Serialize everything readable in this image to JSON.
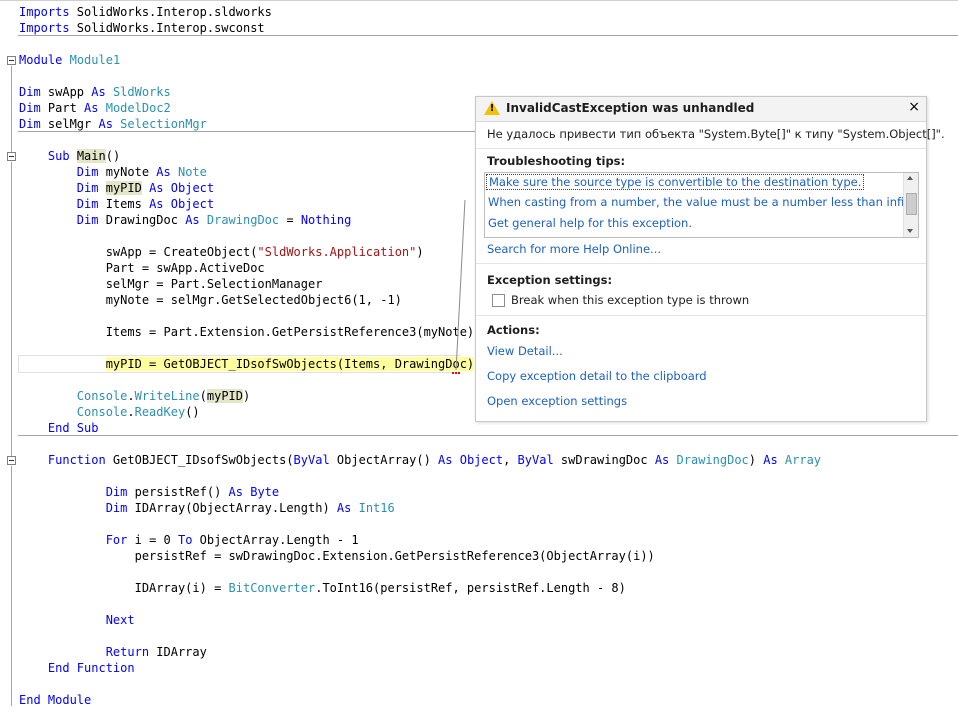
{
  "code": {
    "lines": [
      {
        "tokens": [
          {
            "t": "Imports",
            "c": "kw"
          },
          {
            "t": " SolidWorks.Interop.sldworks",
            "c": ""
          }
        ]
      },
      {
        "tokens": [
          {
            "t": "Imports",
            "c": "kw"
          },
          {
            "t": " SolidWorks.Interop.swconst",
            "c": ""
          }
        ]
      },
      {
        "tokens": []
      },
      {
        "tokens": [
          {
            "t": "Module",
            "c": "kw"
          },
          {
            "t": " ",
            "c": ""
          },
          {
            "t": "Module1",
            "c": "ty"
          }
        ]
      },
      {
        "tokens": []
      },
      {
        "tokens": [
          {
            "t": "Dim",
            "c": "kw"
          },
          {
            "t": " swApp ",
            "c": ""
          },
          {
            "t": "As",
            "c": "kw"
          },
          {
            "t": " ",
            "c": ""
          },
          {
            "t": "SldWorks",
            "c": "ty"
          }
        ]
      },
      {
        "tokens": [
          {
            "t": "Dim",
            "c": "kw"
          },
          {
            "t": " Part ",
            "c": ""
          },
          {
            "t": "As",
            "c": "kw"
          },
          {
            "t": " ",
            "c": ""
          },
          {
            "t": "ModelDoc2",
            "c": "ty"
          }
        ]
      },
      {
        "tokens": [
          {
            "t": "Dim",
            "c": "kw"
          },
          {
            "t": " selMgr ",
            "c": ""
          },
          {
            "t": "As",
            "c": "kw"
          },
          {
            "t": " ",
            "c": ""
          },
          {
            "t": "SelectionMgr",
            "c": "ty"
          }
        ]
      },
      {
        "tokens": []
      },
      {
        "tokens": [
          {
            "t": "    ",
            "c": ""
          },
          {
            "t": "Sub",
            "c": "kw"
          },
          {
            "t": " ",
            "c": ""
          },
          {
            "t": "Main",
            "c": "hl"
          },
          {
            "t": "()",
            "c": ""
          }
        ]
      },
      {
        "tokens": [
          {
            "t": "        ",
            "c": ""
          },
          {
            "t": "Dim",
            "c": "kw"
          },
          {
            "t": " myNote ",
            "c": ""
          },
          {
            "t": "As",
            "c": "kw"
          },
          {
            "t": " ",
            "c": ""
          },
          {
            "t": "Note",
            "c": "ty"
          }
        ]
      },
      {
        "tokens": [
          {
            "t": "        ",
            "c": ""
          },
          {
            "t": "Dim",
            "c": "kw"
          },
          {
            "t": " ",
            "c": ""
          },
          {
            "t": "myPID",
            "c": "hl"
          },
          {
            "t": " ",
            "c": ""
          },
          {
            "t": "As",
            "c": "kw"
          },
          {
            "t": " ",
            "c": ""
          },
          {
            "t": "Object",
            "c": "kw"
          }
        ]
      },
      {
        "tokens": [
          {
            "t": "        ",
            "c": ""
          },
          {
            "t": "Dim",
            "c": "kw"
          },
          {
            "t": " Items ",
            "c": ""
          },
          {
            "t": "As",
            "c": "kw"
          },
          {
            "t": " ",
            "c": ""
          },
          {
            "t": "Object",
            "c": "kw"
          }
        ]
      },
      {
        "tokens": [
          {
            "t": "        ",
            "c": ""
          },
          {
            "t": "Dim",
            "c": "kw"
          },
          {
            "t": " DrawingDoc ",
            "c": ""
          },
          {
            "t": "As",
            "c": "kw"
          },
          {
            "t": " ",
            "c": ""
          },
          {
            "t": "DrawingDoc",
            "c": "ty"
          },
          {
            "t": " = ",
            "c": ""
          },
          {
            "t": "Nothing",
            "c": "kw"
          }
        ]
      },
      {
        "tokens": []
      },
      {
        "tokens": [
          {
            "t": "            swApp = CreateObject(",
            "c": ""
          },
          {
            "t": "\"SldWorks.Application\"",
            "c": "str"
          },
          {
            "t": ")",
            "c": ""
          }
        ]
      },
      {
        "tokens": [
          {
            "t": "            Part = swApp.ActiveDoc",
            "c": ""
          }
        ]
      },
      {
        "tokens": [
          {
            "t": "            selMgr = Part.SelectionManager",
            "c": ""
          }
        ]
      },
      {
        "tokens": [
          {
            "t": "            myNote = selMgr.GetSelectedObject6(1, -1)",
            "c": ""
          }
        ]
      },
      {
        "tokens": []
      },
      {
        "tokens": [
          {
            "t": "            Items = Part.Extension.GetPersistReference3(myNote)",
            "c": ""
          }
        ]
      },
      {
        "tokens": []
      },
      {
        "tokens": [
          {
            "t": "            myPID = GetOBJECT_IDsofSwObjects(Items, DrawingDoc)",
            "c": "exec"
          }
        ]
      },
      {
        "tokens": []
      },
      {
        "tokens": [
          {
            "t": "        ",
            "c": ""
          },
          {
            "t": "Console",
            "c": "ty"
          },
          {
            "t": ".",
            "c": ""
          },
          {
            "t": "WriteLine",
            "c": "ty"
          },
          {
            "t": "(",
            "c": ""
          },
          {
            "t": "myPID",
            "c": "hl"
          },
          {
            "t": ")",
            "c": ""
          }
        ]
      },
      {
        "tokens": [
          {
            "t": "        ",
            "c": ""
          },
          {
            "t": "Console",
            "c": "ty"
          },
          {
            "t": ".",
            "c": ""
          },
          {
            "t": "ReadKey",
            "c": "ty"
          },
          {
            "t": "()",
            "c": ""
          }
        ]
      },
      {
        "tokens": [
          {
            "t": "    ",
            "c": ""
          },
          {
            "t": "End Sub",
            "c": "kw"
          }
        ]
      },
      {
        "tokens": []
      },
      {
        "tokens": [
          {
            "t": "    ",
            "c": ""
          },
          {
            "t": "Function",
            "c": "kw"
          },
          {
            "t": " GetOBJECT_IDsofSwObjects(",
            "c": ""
          },
          {
            "t": "ByVal",
            "c": "kw"
          },
          {
            "t": " ObjectArray() ",
            "c": ""
          },
          {
            "t": "As",
            "c": "kw"
          },
          {
            "t": " ",
            "c": ""
          },
          {
            "t": "Object",
            "c": "kw"
          },
          {
            "t": ", ",
            "c": ""
          },
          {
            "t": "ByVal",
            "c": "kw"
          },
          {
            "t": " swDrawingDoc ",
            "c": ""
          },
          {
            "t": "As",
            "c": "kw"
          },
          {
            "t": " ",
            "c": ""
          },
          {
            "t": "DrawingDoc",
            "c": "ty"
          },
          {
            "t": ") ",
            "c": ""
          },
          {
            "t": "As",
            "c": "kw"
          },
          {
            "t": " ",
            "c": ""
          },
          {
            "t": "Array",
            "c": "ty"
          }
        ]
      },
      {
        "tokens": []
      },
      {
        "tokens": [
          {
            "t": "            ",
            "c": ""
          },
          {
            "t": "Dim",
            "c": "kw"
          },
          {
            "t": " persistRef() ",
            "c": ""
          },
          {
            "t": "As",
            "c": "kw"
          },
          {
            "t": " ",
            "c": ""
          },
          {
            "t": "Byte",
            "c": "kw"
          }
        ]
      },
      {
        "tokens": [
          {
            "t": "            ",
            "c": ""
          },
          {
            "t": "Dim",
            "c": "kw"
          },
          {
            "t": " IDArray(ObjectArray.Length) ",
            "c": ""
          },
          {
            "t": "As",
            "c": "kw"
          },
          {
            "t": " ",
            "c": ""
          },
          {
            "t": "Int16",
            "c": "ty"
          }
        ]
      },
      {
        "tokens": []
      },
      {
        "tokens": [
          {
            "t": "            ",
            "c": ""
          },
          {
            "t": "For",
            "c": "kw"
          },
          {
            "t": " i = 0 ",
            "c": ""
          },
          {
            "t": "To",
            "c": "kw"
          },
          {
            "t": " ObjectArray.Length - 1",
            "c": ""
          }
        ]
      },
      {
        "tokens": [
          {
            "t": "                persistRef = swDrawingDoc.Extension.GetPersistReference3(ObjectArray(i))",
            "c": ""
          }
        ]
      },
      {
        "tokens": []
      },
      {
        "tokens": [
          {
            "t": "                IDArray(i) = ",
            "c": ""
          },
          {
            "t": "BitConverter",
            "c": "ty"
          },
          {
            "t": ".ToInt16(persistRef, persistRef.Length - 8)",
            "c": ""
          }
        ]
      },
      {
        "tokens": []
      },
      {
        "tokens": [
          {
            "t": "            ",
            "c": ""
          },
          {
            "t": "Next",
            "c": "kw"
          }
        ]
      },
      {
        "tokens": []
      },
      {
        "tokens": [
          {
            "t": "            ",
            "c": ""
          },
          {
            "t": "Return",
            "c": "kw"
          },
          {
            "t": " IDArray",
            "c": ""
          }
        ]
      },
      {
        "tokens": [
          {
            "t": "    ",
            "c": ""
          },
          {
            "t": "End Function",
            "c": "kw"
          }
        ]
      },
      {
        "tokens": []
      },
      {
        "tokens": [
          {
            "t": "End Module",
            "c": "kw"
          }
        ]
      }
    ]
  },
  "exception": {
    "title": "InvalidCastException was unhandled",
    "close_glyph": "×",
    "message": "Не удалось привести тип объекта \"System.Byte[]\" к типу \"System.Object[]\".",
    "tips_heading": "Troubleshooting tips:",
    "tips": [
      "Make sure the source type is convertible to the destination type.",
      "When casting from a number, the value must be a number less than infinity.",
      "Get general help for this exception."
    ],
    "search_link": "Search for more Help Online...",
    "settings_heading": "Exception settings:",
    "break_checkbox_label": "Break when this exception type is thrown",
    "break_checked": false,
    "actions_heading": "Actions:",
    "actions": [
      "View Detail...",
      "Copy exception detail to the clipboard",
      "Open exception settings"
    ]
  }
}
